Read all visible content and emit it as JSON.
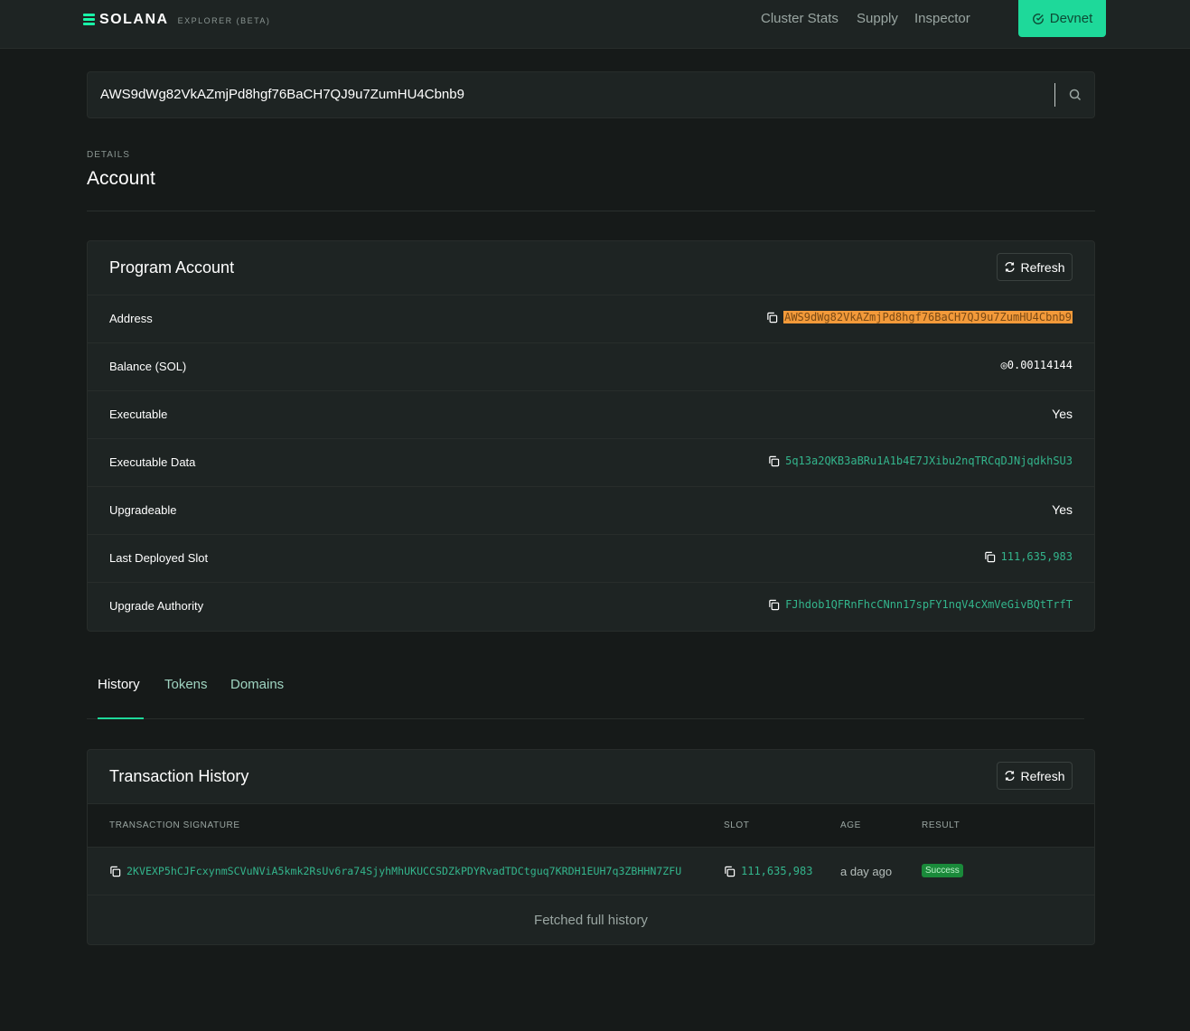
{
  "nav": {
    "brand": "SOLANA",
    "brand_sub": "EXPLORER (BETA)",
    "links": [
      "Cluster Stats",
      "Supply",
      "Inspector"
    ],
    "cluster_button": "Devnet"
  },
  "search": {
    "value": "AWS9dWg82VkAZmjPd8hgf76BaCH7QJ9u7ZumHU4Cbnb9"
  },
  "header": {
    "pretitle": "DETAILS",
    "title": "Account"
  },
  "account_card": {
    "title": "Program Account",
    "refresh_label": "Refresh",
    "rows": {
      "address": {
        "label": "Address",
        "value": "AWS9dWg82VkAZmjPd8hgf76BaCH7QJ9u7ZumHU4Cbnb9"
      },
      "balance": {
        "label": "Balance (SOL)",
        "value": "◎0.00114144"
      },
      "executable": {
        "label": "Executable",
        "value": "Yes"
      },
      "executable_data": {
        "label": "Executable Data",
        "value": "5q13a2QKB3aBRu1A1b4E7JXibu2nqTRCqDJNjqdkhSU3"
      },
      "upgradeable": {
        "label": "Upgradeable",
        "value": "Yes"
      },
      "last_deployed_slot": {
        "label": "Last Deployed Slot",
        "value": "111,635,983"
      },
      "upgrade_authority": {
        "label": "Upgrade Authority",
        "value": "FJhdob1QFRnFhcCNnn17spFY1nqV4cXmVeGivBQtTrfT"
      }
    }
  },
  "tabs": [
    "History",
    "Tokens",
    "Domains"
  ],
  "history_card": {
    "title": "Transaction History",
    "refresh_label": "Refresh",
    "columns": [
      "TRANSACTION SIGNATURE",
      "SLOT",
      "AGE",
      "RESULT"
    ],
    "rows": [
      {
        "signature": "2KVEXP5hCJFcxynmSCVuNViA5kmk2RsUv6ra74SjyhMhUKUCCSDZkPDYRvadTDCtguq7KRDH1EUH7q3ZBHHN7ZFU",
        "slot": "111,635,983",
        "age": "a day ago",
        "result": "Success"
      }
    ],
    "footer": "Fetched full history"
  },
  "colors": {
    "accent": "#1ed99a",
    "link": "#33b58c",
    "highlight": "#f39a3a",
    "success": "#1a8a3a"
  }
}
